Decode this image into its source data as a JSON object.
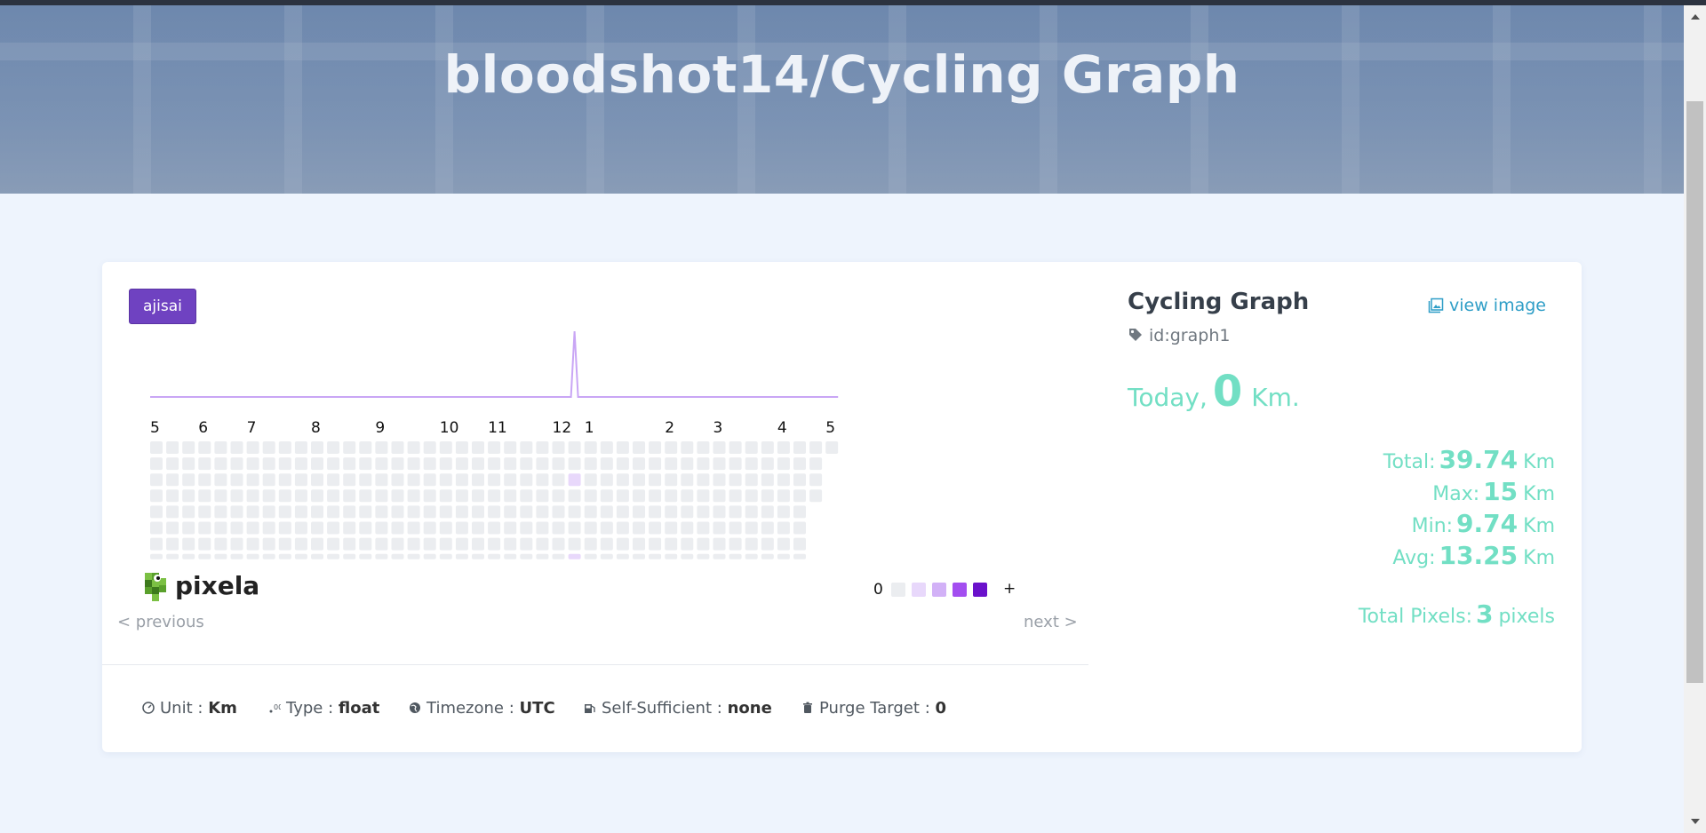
{
  "header": {
    "title": "bloodshot14/Cycling Graph"
  },
  "graph": {
    "theme_label": "ajisai",
    "month_labels": [
      "5",
      "6",
      "7",
      "8",
      "9",
      "10",
      "11",
      "12",
      "1",
      "2",
      "3",
      "4",
      "5"
    ],
    "legend": {
      "min_label": "0",
      "max_label": "+",
      "colors": [
        "#ebedf0",
        "#e8d8fb",
        "#d2b1f7",
        "#a34ef0",
        "#6a11cb"
      ]
    },
    "nav": {
      "previous": "< previous",
      "next": "next >"
    },
    "logo_text": "pixela"
  },
  "info": {
    "unit_label": "Unit",
    "unit_value": "Km",
    "type_label": "Type",
    "type_value": "float",
    "timezone_label": "Timezone",
    "timezone_value": "UTC",
    "self_sufficient_label": "Self-Sufficient",
    "self_sufficient_value": "none",
    "purge_label": "Purge Target",
    "purge_value": "0",
    "separator": ":"
  },
  "side": {
    "title": "Cycling Graph",
    "id": "id:graph1",
    "view_image": "view image",
    "today_label": "Today",
    "today_sep": ",",
    "today_value": "0",
    "today_unit": "Km.",
    "stats": [
      {
        "label": "Total:",
        "value": "39.74",
        "unit": "Km"
      },
      {
        "label": "Max:",
        "value": "15",
        "unit": "Km"
      },
      {
        "label": "Min:",
        "value": "9.74",
        "unit": "Km"
      },
      {
        "label": "Avg:",
        "value": "13.25",
        "unit": "Km"
      }
    ],
    "total_pixels_label": "Total Pixels:",
    "total_pixels_value": "3",
    "total_pixels_unit": "pixels"
  },
  "colors": {
    "accent": "#6f42c1",
    "stat_text": "#72dfc4",
    "link": "#2f9ec7"
  }
}
